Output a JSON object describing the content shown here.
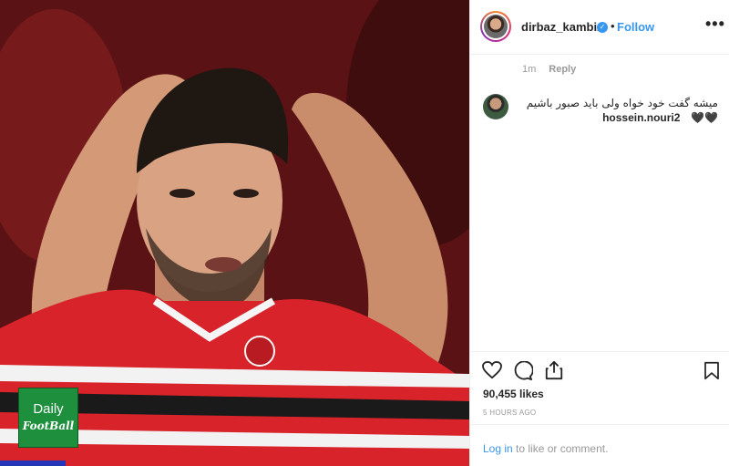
{
  "post": {
    "username": "dirbaz_kambiz",
    "verified_icon": "verified-badge-icon",
    "separator": "•",
    "follow_label": "Follow",
    "more_label": "•••"
  },
  "reply_meta": {
    "time": "1m",
    "reply_label": "Reply"
  },
  "comment": {
    "username": "hossein.nouri2",
    "text": "میشه گفت خود خواه ولی باید صبور باشیم🖤🖤"
  },
  "actions": {
    "likes": "90,455 likes",
    "posted": "5 HOURS AGO",
    "login_label": "Log in",
    "login_suffix": " to like or comment."
  },
  "watermark": {
    "top": "Daily",
    "bottom": "FootBall"
  },
  "colors": {
    "accent": "#3897f0",
    "watermark_bg": "#1e8f3c"
  }
}
